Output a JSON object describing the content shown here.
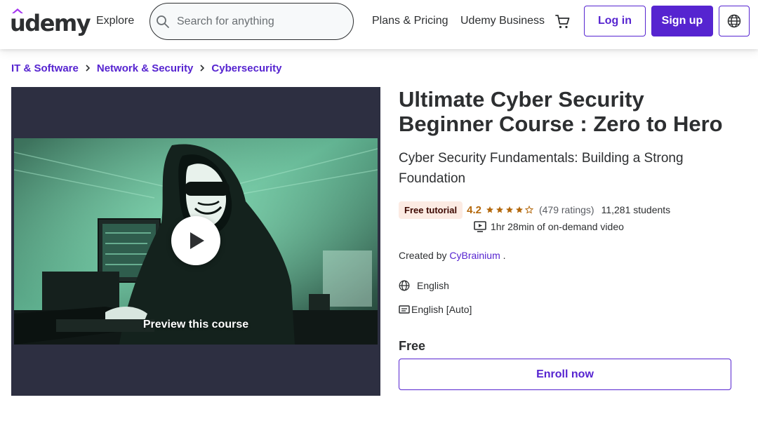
{
  "header": {
    "logo_text": "udemy",
    "explore_label": "Explore",
    "search": {
      "placeholder": "Search for anything",
      "value": ""
    },
    "plans_label": "Plans & Pricing",
    "business_label": "Udemy Business",
    "login_label": "Log in",
    "signup_label": "Sign up"
  },
  "breadcrumb": [
    "IT & Software",
    "Network & Security",
    "Cybersecurity"
  ],
  "preview": {
    "label": "Preview this course"
  },
  "course": {
    "title": "Ultimate Cyber Security Beginner Course : Zero to Hero",
    "subtitle": "Cyber Security Fundamentals: Building a Strong Foundation",
    "badge": "Free tutorial",
    "rating": "4.2",
    "rating_value": 4.2,
    "ratings_count": "(479 ratings)",
    "students": "11,281 students",
    "video_length": "1hr 28min of on-demand video",
    "created_by_prefix": "Created by",
    "instructor": "CyBrainium",
    "created_by_suffix": ".",
    "language": "English",
    "captions": "English [Auto]",
    "price": "Free",
    "enroll_label": "Enroll now"
  },
  "colors": {
    "brand": "#5624d0",
    "rating": "#b4690e",
    "badge_bg": "#fcebe3",
    "preview_bg": "#2d2f41"
  }
}
